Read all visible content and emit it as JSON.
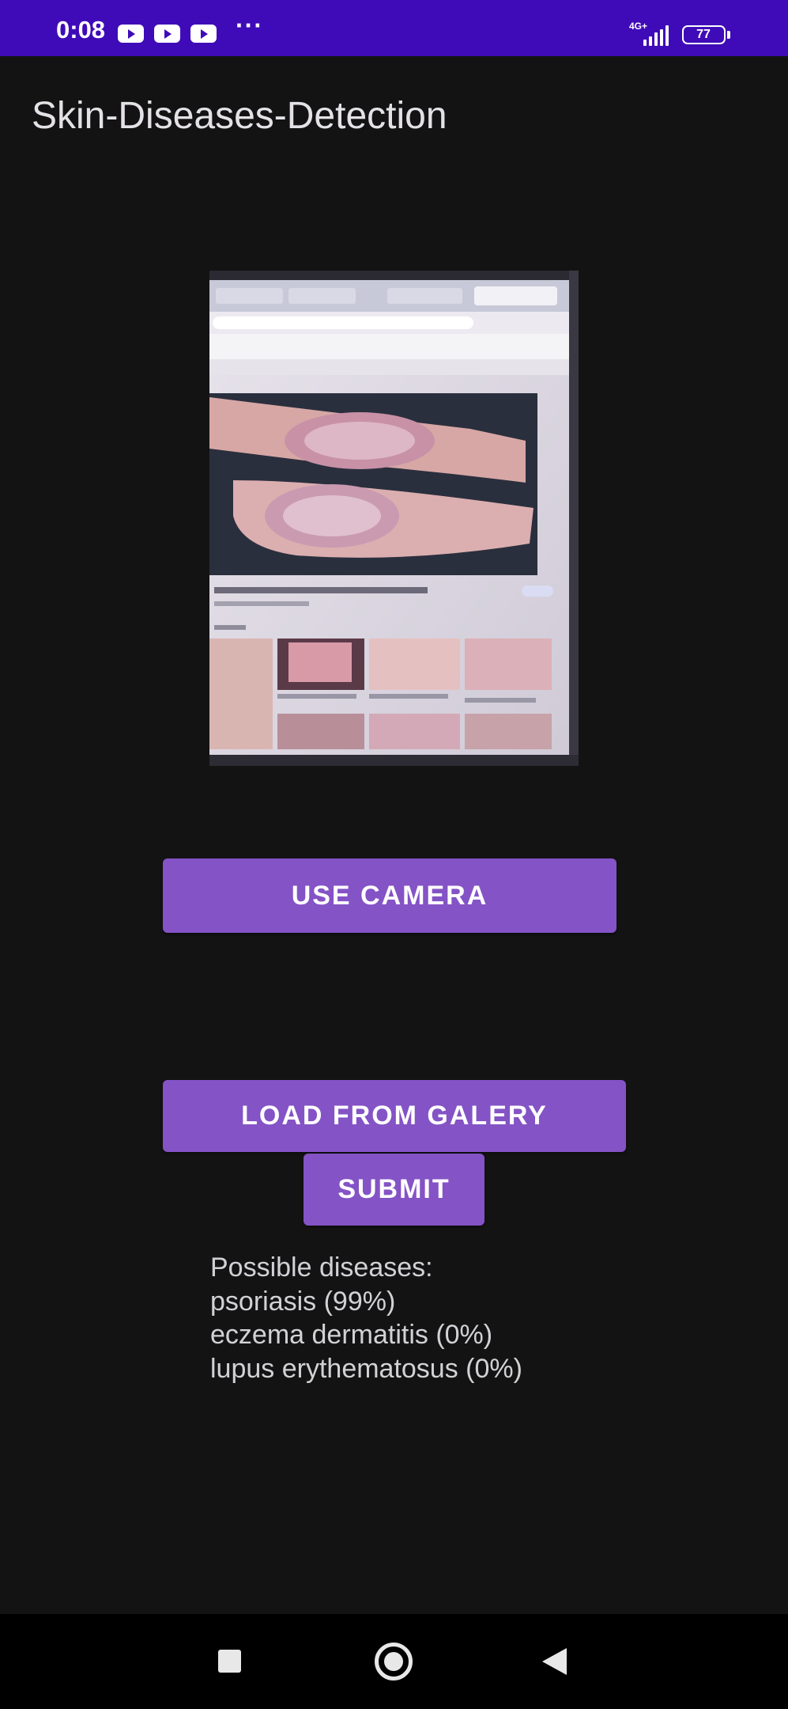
{
  "status_bar": {
    "time": "0:08",
    "more": "···",
    "network": "4G+",
    "battery": "77",
    "icons": [
      "youtube-icon",
      "youtube-icon",
      "youtube-icon",
      "more-dots-icon",
      "signal-icon",
      "battery-icon"
    ]
  },
  "app": {
    "title": "Skin-Diseases-Detection"
  },
  "colors": {
    "status_bar": "#3f0bb8",
    "background": "#141314",
    "button": "#8453c6",
    "button_text": "#ffffff",
    "result_text": "#d2d1d5"
  },
  "buttons": {
    "camera": "USE CAMERA",
    "gallery": "LOAD FROM GALERY",
    "submit": "SUBMIT"
  },
  "results": {
    "header": "Possible diseases:",
    "items": [
      "psoriasis (99%)",
      "eczema dermatitis (0%)",
      "lupus erythematosus (0%)"
    ]
  },
  "nav_bar": {
    "icons": [
      "recents-square-icon",
      "home-circle-icon",
      "back-triangle-icon"
    ]
  }
}
